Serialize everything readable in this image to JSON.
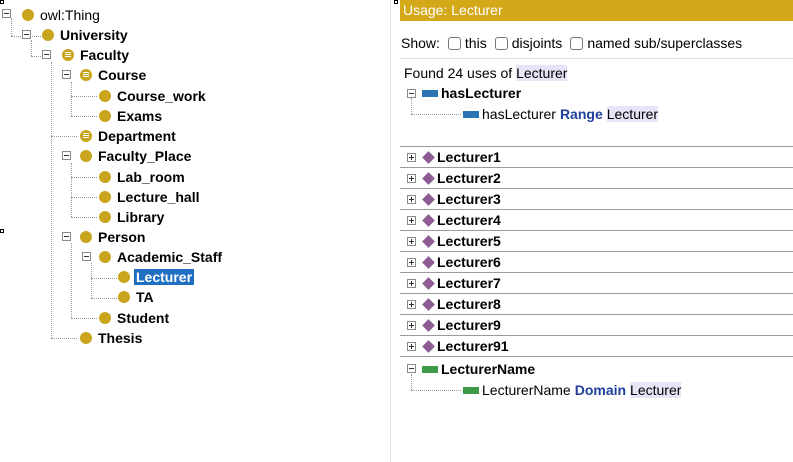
{
  "class_tree": {
    "root": "owl:Thing",
    "nodes": [
      {
        "label": "University"
      },
      {
        "label": "Faculty"
      },
      {
        "label": "Course"
      },
      {
        "label": "Course_work"
      },
      {
        "label": "Exams"
      },
      {
        "label": "Department"
      },
      {
        "label": "Faculty_Place"
      },
      {
        "label": "Lab_room"
      },
      {
        "label": "Lecture_hall"
      },
      {
        "label": "Library"
      },
      {
        "label": "Person"
      },
      {
        "label": "Academic_Staff"
      },
      {
        "label": "Lecturer",
        "selected": true
      },
      {
        "label": "TA"
      },
      {
        "label": "Student"
      },
      {
        "label": "Thesis"
      }
    ]
  },
  "usage": {
    "title": "Usage: Lecturer",
    "show_label": "Show:",
    "filters": [
      {
        "label": "this",
        "checked": false
      },
      {
        "label": "disjoints",
        "checked": false
      },
      {
        "label": "named sub/superclasses",
        "checked": false
      }
    ],
    "found_prefix": "Found 24 uses of",
    "found_entity": "Lecturer",
    "object_property": {
      "name": "hasLecturer",
      "axiom_subject": "hasLecturer",
      "axiom_keyword": "Range",
      "axiom_object": "Lecturer"
    },
    "individuals": [
      "Lecturer1",
      "Lecturer2",
      "Lecturer3",
      "Lecturer4",
      "Lecturer5",
      "Lecturer6",
      "Lecturer7",
      "Lecturer8",
      "Lecturer9",
      "Lecturer91"
    ],
    "data_property": {
      "name": "LecturerName",
      "axiom_subject": "LecturerName",
      "axiom_keyword": "Domain",
      "axiom_object": "Lecturer"
    }
  },
  "colors": {
    "class_icon": "#c9a51d",
    "selection": "#1f6fc3",
    "usage_header": "#d3a91a",
    "individual_icon": "#8e5c92",
    "object_property_icon": "#2b75b5",
    "data_property_icon": "#3f9a48",
    "keyword": "#1f3f9c"
  },
  "icons": {
    "class": "class-circle-icon",
    "defined_class": "defined-class-icon",
    "individual": "individual-diamond-icon",
    "object_property": "object-property-icon",
    "data_property": "data-property-icon"
  }
}
